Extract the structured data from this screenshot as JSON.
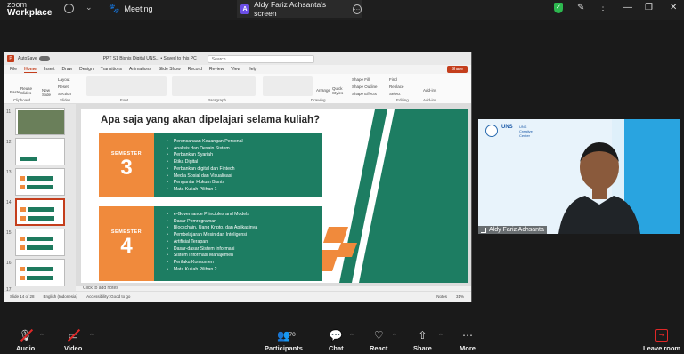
{
  "window": {
    "brand_line1": "zoom",
    "brand_line2": "Workplace",
    "meeting_tab": "Meeting",
    "screen_tab": "Aldy Fariz Achsanta's screen",
    "screen_tab_initial": "A",
    "top_caret": "⌄"
  },
  "ppt": {
    "autosave": "AutoSave",
    "toggle": "Off",
    "doc_name": "PPT S1 Bisnis Digital UNS... • Saved to this PC",
    "search_placeholder": "Search",
    "menu": [
      "File",
      "Home",
      "Insert",
      "Draw",
      "Design",
      "Transitions",
      "Animations",
      "Slide Show",
      "Record",
      "Review",
      "View",
      "Help"
    ],
    "share": "Share",
    "ribbon_groups": [
      "Clipboard",
      "Slides",
      "Font",
      "Paragraph",
      "Drawing",
      "Editing",
      "Add-ins"
    ],
    "ribbon_buttons": {
      "paste": "Paste",
      "new_slide": "New Slide",
      "reuse_slides": "Reuse Slides",
      "layout": "Layout",
      "reset": "Reset",
      "section": "Section",
      "arrange": "Arrange",
      "quick_styles": "Quick Styles",
      "shape_fill": "Shape Fill",
      "shape_outline": "Shape Outline",
      "shape_effects": "Shape Effects",
      "find": "Find",
      "replace": "Replace",
      "select": "Select",
      "addins": "Add-ins"
    },
    "thumb_numbers": [
      "11",
      "12",
      "13",
      "14",
      "15",
      "16",
      "17"
    ],
    "notes": "Click to add notes",
    "status_slide": "Slide 14 of 28",
    "status_lang": "English (Indonesia)",
    "status_access": "Accessibility: Good to go",
    "status_notes": "Notes",
    "status_zoom": "31%"
  },
  "slide": {
    "title": "Apa saja yang akan dipelajari selama kuliah?",
    "semesters": [
      {
        "label": "SEMESTER",
        "number": "3",
        "subjects": [
          "Perencanaan Keuangan Personal",
          "Analisis dan Desain Sistem",
          "Perbankan Syariah",
          "Etika Digital",
          "Perbankan digital dan Fintech",
          "Media Sosial dan Visualisasi",
          "Pengantar Hukum Bisnis",
          "Mata Kuliah Pilihan 1"
        ]
      },
      {
        "label": "SEMESTER",
        "number": "4",
        "subjects": [
          "e-Governance Principles and Models",
          "Dasar Pemrograman",
          "Blockchain, Uang Kripto, dan Aplikasinya",
          "Pembelajaran Mesin dan Inteligensi",
          "Artifisial Terapan",
          "Dasar-dasar Sistem Informasi",
          "Sistem Informasi Manajemen",
          "Perilaku Konsumen",
          "Mata Kuliah Pilihan 2"
        ]
      }
    ],
    "colors": {
      "green": "#1d7d62",
      "orange": "#f08a3c"
    }
  },
  "video": {
    "name": "Aldy Fariz Achsanta",
    "uns": "UNS",
    "uns_center": "UNS Creative Center",
    "background_color": "#29a4e0"
  },
  "toolbar": {
    "audio": "Audio",
    "video": "Video",
    "participants": "Participants",
    "participants_count": "70",
    "chat": "Chat",
    "react": "React",
    "share": "Share",
    "more": "More",
    "leave": "Leave room",
    "caret": "⌃"
  }
}
